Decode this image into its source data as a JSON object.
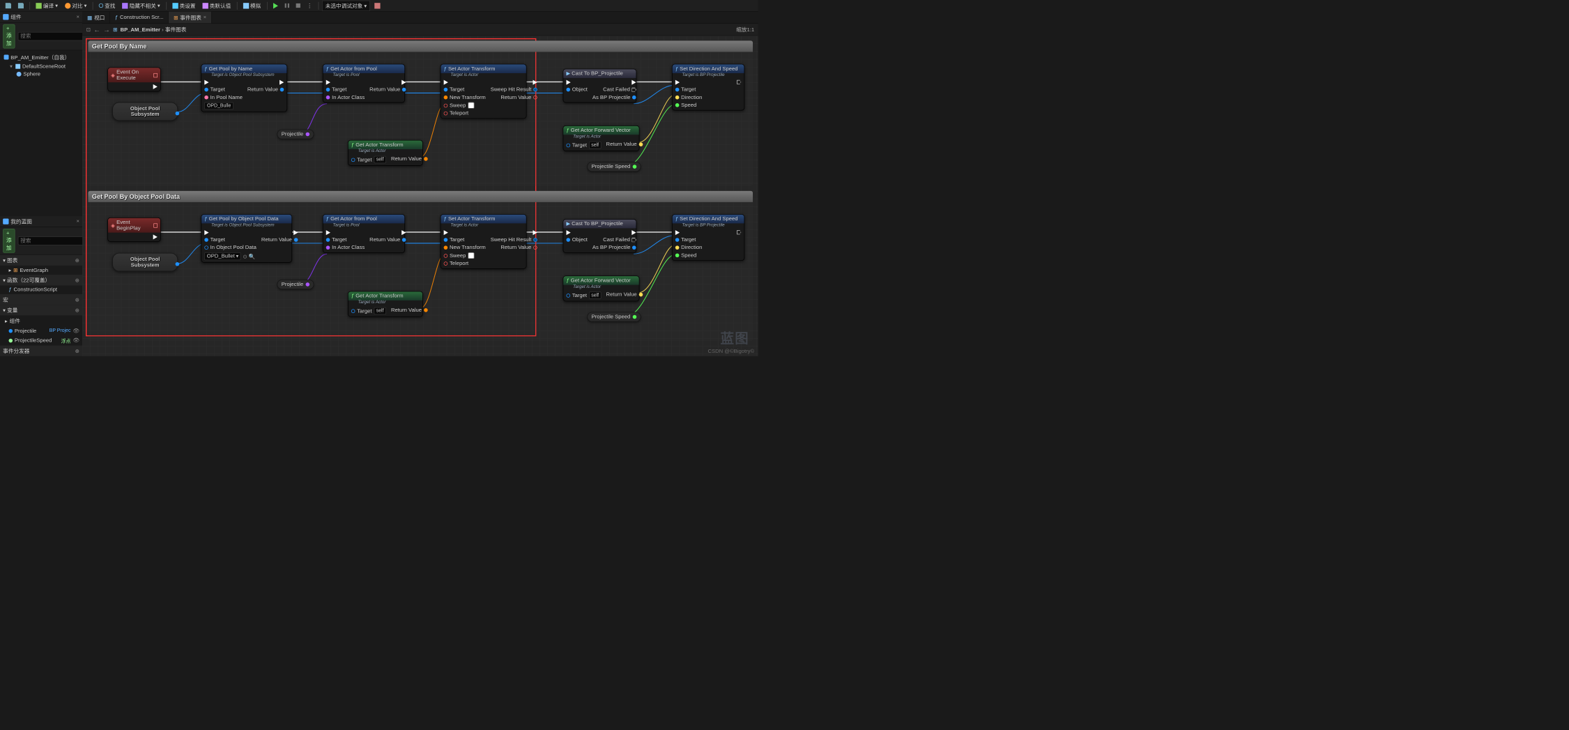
{
  "toolbar": {
    "save": "",
    "compile": "编译",
    "diff": "对比",
    "find": "查找",
    "hide": "隐藏不相关",
    "class_settings": "类设置",
    "class_defaults": "类默认值",
    "simulate": "模拟",
    "debug_target": "未选中调试对象"
  },
  "components": {
    "title": "组件",
    "add": "+ 添加",
    "search_ph": "搜索",
    "root": "BP_AM_Emitter（自我）",
    "scene": "DefaultSceneRoot",
    "sphere": "Sphere"
  },
  "mybp": {
    "title": "我的蓝图",
    "add": "+ 添加",
    "search_ph": "搜索",
    "graphs": "图表",
    "eventgraph": "EventGraph",
    "functions": "函数（22可覆盖）",
    "cs": "ConstructionScript",
    "macros": "宏",
    "variables": "变量",
    "vars_comp": "组件",
    "var1": "Projectile",
    "var1_type": "BP Projec",
    "var2": "ProjectileSpeed",
    "var2_type": "浮点",
    "dispatchers": "事件分发器"
  },
  "tabs": {
    "viewport": "视口",
    "cs": "Construction Scr...",
    "eg": "事件图表"
  },
  "subbar": {
    "bp": "BP_AM_Emitter",
    "graph": "事件图表",
    "zoom": "缩放1:1"
  },
  "sections": {
    "s1": "Get Pool By Name",
    "s2": "Get Pool By Object Pool Data"
  },
  "nodes": {
    "event_exec": "Event On Execute",
    "event_begin": "Event BeginPlay",
    "subsys": "Object Pool\nSubsystem",
    "gpn": {
      "title": "Get Pool by Name",
      "sub": "Target is Object Pool Subsystem",
      "target": "Target",
      "pool_name": "In Pool Name",
      "pool_val": "OPD_Bullet",
      "ret": "Return Value"
    },
    "gpd": {
      "title": "Get Pool by Object Pool Data",
      "sub": "Target is Object Pool Subsystem",
      "target": "Target",
      "pool_data": "In Object Pool Data",
      "pool_val": "OPD_Bullet",
      "ret": "Return Value"
    },
    "gaf": {
      "title": "Get Actor from Pool",
      "sub": "Target is Pool",
      "target": "Target",
      "actor_class": "In Actor Class",
      "ret": "Return Value"
    },
    "sat": {
      "title": "Set Actor Transform",
      "sub": "Target is Actor",
      "target": "Target",
      "new_tr": "New Transform",
      "sweep": "Sweep",
      "teleport": "Teleport",
      "hit": "Sweep Hit Result",
      "ret": "Return Value"
    },
    "gat": {
      "title": "Get Actor Transform",
      "sub": "Target is Actor",
      "target": "Target",
      "self": "self",
      "ret": "Return Value"
    },
    "cast": {
      "title": "Cast To BP_Projectile",
      "obj": "Object",
      "failed": "Cast Failed",
      "as": "As BP Projectile"
    },
    "gfv": {
      "title": "Get Actor Forward Vector",
      "sub": "Target is Actor",
      "target": "Target",
      "self": "self",
      "ret": "Return Value"
    },
    "sds": {
      "title": "Set Direction And Speed",
      "sub": "Target is BP Projectile",
      "target": "Target",
      "dir": "Direction",
      "speed": "Speed"
    },
    "proj": "Projectile",
    "speed": "Projectile Speed"
  },
  "watermark": "CSDN @©Bigotry©",
  "wm_big": "蓝图"
}
